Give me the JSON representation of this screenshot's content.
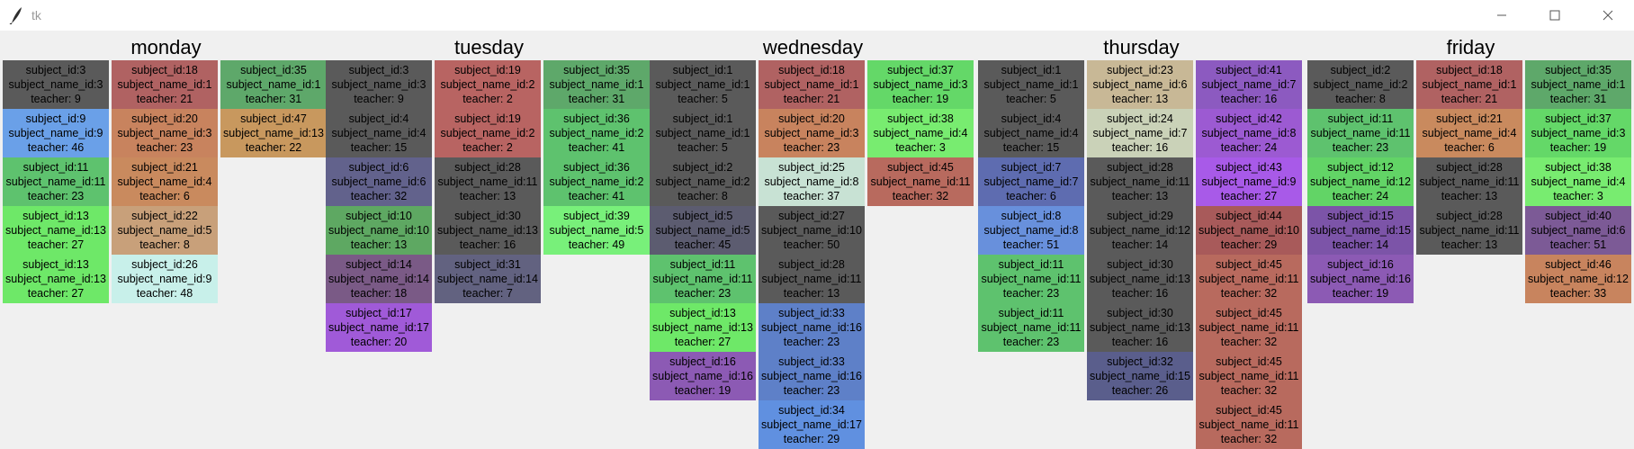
{
  "window": {
    "title": "tk"
  },
  "icons": {
    "app": "feather-icon",
    "minimize": "minimize-icon",
    "maximize": "maximize-icon",
    "close": "close-icon"
  },
  "days": [
    {
      "name": "monday",
      "columns": [
        [
          {
            "subject_id": "subject_id:3",
            "subject_name_id": "subject_name_id:3",
            "teacher": "teacher: 9",
            "color": "#5a5a5a"
          },
          {
            "subject_id": "subject_id:9",
            "subject_name_id": "subject_name_id:9",
            "teacher": "teacher: 46",
            "color": "#6aa0e8"
          },
          {
            "subject_id": "subject_id:11",
            "subject_name_id": "subject_name_id:11",
            "teacher": "teacher: 23",
            "color": "#5ec26e"
          },
          {
            "subject_id": "subject_id:13",
            "subject_name_id": "subject_name_id:13",
            "teacher": "teacher: 27",
            "color": "#6ee868"
          },
          {
            "subject_id": "subject_id:13",
            "subject_name_id": "subject_name_id:13",
            "teacher": "teacher: 27",
            "color": "#6ee868"
          }
        ],
        [
          {
            "subject_id": "subject_id:18",
            "subject_name_id": "subject_name_id:1",
            "teacher": "teacher: 21",
            "color": "#b06262"
          },
          {
            "subject_id": "subject_id:20",
            "subject_name_id": "subject_name_id:3",
            "teacher": "teacher: 23",
            "color": "#c8835e"
          },
          {
            "subject_id": "subject_id:21",
            "subject_name_id": "subject_name_id:4",
            "teacher": "teacher: 6",
            "color": "#c98a5e"
          },
          {
            "subject_id": "subject_id:22",
            "subject_name_id": "subject_name_id:5",
            "teacher": "teacher: 8",
            "color": "#c8a07a"
          },
          {
            "subject_id": "subject_id:26",
            "subject_name_id": "subject_name_id:9",
            "teacher": "teacher: 48",
            "color": "#c8f0ea"
          }
        ],
        [
          {
            "subject_id": "subject_id:35",
            "subject_name_id": "subject_name_id:1",
            "teacher": "teacher: 31",
            "color": "#5ea86a"
          },
          {
            "subject_id": "subject_id:47",
            "subject_name_id": "subject_name_id:13",
            "teacher": "teacher: 22",
            "color": "#c8985e"
          }
        ]
      ]
    },
    {
      "name": "tuesday",
      "columns": [
        [
          {
            "subject_id": "subject_id:3",
            "subject_name_id": "subject_name_id:3",
            "teacher": "teacher: 9",
            "color": "#5a5a5a"
          },
          {
            "subject_id": "subject_id:4",
            "subject_name_id": "subject_name_id:4",
            "teacher": "teacher: 15",
            "color": "#5a5a5a"
          },
          {
            "subject_id": "subject_id:6",
            "subject_name_id": "subject_name_id:6",
            "teacher": "teacher: 32",
            "color": "#62628c"
          },
          {
            "subject_id": "subject_id:10",
            "subject_name_id": "subject_name_id:10",
            "teacher": "teacher: 13",
            "color": "#5ea862"
          },
          {
            "subject_id": "subject_id:14",
            "subject_name_id": "subject_name_id:14",
            "teacher": "teacher: 18",
            "color": "#7a5a86"
          },
          {
            "subject_id": "subject_id:17",
            "subject_name_id": "subject_name_id:17",
            "teacher": "teacher: 20",
            "color": "#a05ad8"
          }
        ],
        [
          {
            "subject_id": "subject_id:19",
            "subject_name_id": "subject_name_id:2",
            "teacher": "teacher: 2",
            "color": "#b86462"
          },
          {
            "subject_id": "subject_id:19",
            "subject_name_id": "subject_name_id:2",
            "teacher": "teacher: 2",
            "color": "#b86462"
          },
          {
            "subject_id": "subject_id:28",
            "subject_name_id": "subject_name_id:11",
            "teacher": "teacher: 13",
            "color": "#5a5a5a"
          },
          {
            "subject_id": "subject_id:30",
            "subject_name_id": "subject_name_id:13",
            "teacher": "teacher: 16",
            "color": "#5a5a5a"
          },
          {
            "subject_id": "subject_id:31",
            "subject_name_id": "subject_name_id:14",
            "teacher": "teacher: 7",
            "color": "#626280"
          }
        ],
        [
          {
            "subject_id": "subject_id:35",
            "subject_name_id": "subject_name_id:1",
            "teacher": "teacher: 31",
            "color": "#5ea86a"
          },
          {
            "subject_id": "subject_id:36",
            "subject_name_id": "subject_name_id:2",
            "teacher": "teacher: 41",
            "color": "#5ec26e"
          },
          {
            "subject_id": "subject_id:36",
            "subject_name_id": "subject_name_id:2",
            "teacher": "teacher: 41",
            "color": "#5ec26e"
          },
          {
            "subject_id": "subject_id:39",
            "subject_name_id": "subject_name_id:5",
            "teacher": "teacher: 49",
            "color": "#78f07a"
          }
        ]
      ]
    },
    {
      "name": "wednesday",
      "columns": [
        [
          {
            "subject_id": "subject_id:1",
            "subject_name_id": "subject_name_id:1",
            "teacher": "teacher: 5",
            "color": "#5a5a5a"
          },
          {
            "subject_id": "subject_id:1",
            "subject_name_id": "subject_name_id:1",
            "teacher": "teacher: 5",
            "color": "#5a5a5a"
          },
          {
            "subject_id": "subject_id:2",
            "subject_name_id": "subject_name_id:2",
            "teacher": "teacher: 8",
            "color": "#5a5a5a"
          },
          {
            "subject_id": "subject_id:5",
            "subject_name_id": "subject_name_id:5",
            "teacher": "teacher: 45",
            "color": "#5c5c70"
          },
          {
            "subject_id": "subject_id:11",
            "subject_name_id": "subject_name_id:11",
            "teacher": "teacher: 23",
            "color": "#5ec26e"
          },
          {
            "subject_id": "subject_id:13",
            "subject_name_id": "subject_name_id:13",
            "teacher": "teacher: 27",
            "color": "#6ee868"
          },
          {
            "subject_id": "subject_id:16",
            "subject_name_id": "subject_name_id:16",
            "teacher": "teacher: 19",
            "color": "#8c5ab4"
          }
        ],
        [
          {
            "subject_id": "subject_id:18",
            "subject_name_id": "subject_name_id:1",
            "teacher": "teacher: 21",
            "color": "#b06262"
          },
          {
            "subject_id": "subject_id:20",
            "subject_name_id": "subject_name_id:3",
            "teacher": "teacher: 23",
            "color": "#c8835e"
          },
          {
            "subject_id": "subject_id:25",
            "subject_name_id": "subject_name_id:8",
            "teacher": "teacher: 37",
            "color": "#c8e2d4"
          },
          {
            "subject_id": "subject_id:27",
            "subject_name_id": "subject_name_id:10",
            "teacher": "teacher: 50",
            "color": "#5a5a5a"
          },
          {
            "subject_id": "subject_id:28",
            "subject_name_id": "subject_name_id:11",
            "teacher": "teacher: 13",
            "color": "#5a5a5a"
          },
          {
            "subject_id": "subject_id:33",
            "subject_name_id": "subject_name_id:16",
            "teacher": "teacher: 23",
            "color": "#5e80c8"
          },
          {
            "subject_id": "subject_id:33",
            "subject_name_id": "subject_name_id:16",
            "teacher": "teacher: 23",
            "color": "#5e80c8"
          },
          {
            "subject_id": "subject_id:34",
            "subject_name_id": "subject_name_id:17",
            "teacher": "teacher: 29",
            "color": "#6090e0"
          }
        ],
        [
          {
            "subject_id": "subject_id:37",
            "subject_name_id": "subject_name_id:3",
            "teacher": "teacher: 19",
            "color": "#64d868"
          },
          {
            "subject_id": "subject_id:38",
            "subject_name_id": "subject_name_id:4",
            "teacher": "teacher: 3",
            "color": "#78ec70"
          },
          {
            "subject_id": "subject_id:45",
            "subject_name_id": "subject_name_id:11",
            "teacher": "teacher: 32",
            "color": "#b86a5e"
          }
        ]
      ]
    },
    {
      "name": "thursday",
      "columns": [
        [
          {
            "subject_id": "subject_id:1",
            "subject_name_id": "subject_name_id:1",
            "teacher": "teacher: 5",
            "color": "#5a5a5a"
          },
          {
            "subject_id": "subject_id:4",
            "subject_name_id": "subject_name_id:4",
            "teacher": "teacher: 15",
            "color": "#5a5a5a"
          },
          {
            "subject_id": "subject_id:7",
            "subject_name_id": "subject_name_id:7",
            "teacher": "teacher: 6",
            "color": "#5e6cb0"
          },
          {
            "subject_id": "subject_id:8",
            "subject_name_id": "subject_name_id:8",
            "teacher": "teacher: 51",
            "color": "#6890dc"
          },
          {
            "subject_id": "subject_id:11",
            "subject_name_id": "subject_name_id:11",
            "teacher": "teacher: 23",
            "color": "#5ec26e"
          },
          {
            "subject_id": "subject_id:11",
            "subject_name_id": "subject_name_id:11",
            "teacher": "teacher: 23",
            "color": "#5ec26e"
          }
        ],
        [
          {
            "subject_id": "subject_id:23",
            "subject_name_id": "subject_name_id:6",
            "teacher": "teacher: 13",
            "color": "#c8b896"
          },
          {
            "subject_id": "subject_id:24",
            "subject_name_id": "subject_name_id:7",
            "teacher": "teacher: 16",
            "color": "#cad2b8"
          },
          {
            "subject_id": "subject_id:28",
            "subject_name_id": "subject_name_id:11",
            "teacher": "teacher: 13",
            "color": "#5a5a5a"
          },
          {
            "subject_id": "subject_id:29",
            "subject_name_id": "subject_name_id:12",
            "teacher": "teacher: 14",
            "color": "#5a5a5a"
          },
          {
            "subject_id": "subject_id:30",
            "subject_name_id": "subject_name_id:13",
            "teacher": "teacher: 16",
            "color": "#5a5a5a"
          },
          {
            "subject_id": "subject_id:30",
            "subject_name_id": "subject_name_id:13",
            "teacher": "teacher: 16",
            "color": "#5a5a5a"
          },
          {
            "subject_id": "subject_id:32",
            "subject_name_id": "subject_name_id:15",
            "teacher": "teacher: 26",
            "color": "#5a5e8c"
          }
        ],
        [
          {
            "subject_id": "subject_id:41",
            "subject_name_id": "subject_name_id:7",
            "teacher": "teacher: 16",
            "color": "#8c5ac0"
          },
          {
            "subject_id": "subject_id:42",
            "subject_name_id": "subject_name_id:8",
            "teacher": "teacher: 24",
            "color": "#9c5ad2"
          },
          {
            "subject_id": "subject_id:43",
            "subject_name_id": "subject_name_id:9",
            "teacher": "teacher: 27",
            "color": "#a85ae8"
          },
          {
            "subject_id": "subject_id:44",
            "subject_name_id": "subject_name_id:10",
            "teacher": "teacher: 29",
            "color": "#a85a5a"
          },
          {
            "subject_id": "subject_id:45",
            "subject_name_id": "subject_name_id:11",
            "teacher": "teacher: 32",
            "color": "#b86a5e"
          },
          {
            "subject_id": "subject_id:45",
            "subject_name_id": "subject_name_id:11",
            "teacher": "teacher: 32",
            "color": "#b86a5e"
          },
          {
            "subject_id": "subject_id:45",
            "subject_name_id": "subject_name_id:11",
            "teacher": "teacher: 32",
            "color": "#b86a5e"
          },
          {
            "subject_id": "subject_id:45",
            "subject_name_id": "subject_name_id:11",
            "teacher": "teacher: 32",
            "color": "#b86a5e"
          }
        ]
      ]
    },
    {
      "name": "friday",
      "columns": [
        [
          {
            "subject_id": "subject_id:2",
            "subject_name_id": "subject_name_id:2",
            "teacher": "teacher: 8",
            "color": "#5a5a5a"
          },
          {
            "subject_id": "subject_id:11",
            "subject_name_id": "subject_name_id:11",
            "teacher": "teacher: 23",
            "color": "#5ec26e"
          },
          {
            "subject_id": "subject_id:12",
            "subject_name_id": "subject_name_id:12",
            "teacher": "teacher: 24",
            "color": "#62d466"
          },
          {
            "subject_id": "subject_id:15",
            "subject_name_id": "subject_name_id:15",
            "teacher": "teacher: 14",
            "color": "#7c54a8"
          },
          {
            "subject_id": "subject_id:16",
            "subject_name_id": "subject_name_id:16",
            "teacher": "teacher: 19",
            "color": "#8c5ab4"
          }
        ],
        [
          {
            "subject_id": "subject_id:18",
            "subject_name_id": "subject_name_id:1",
            "teacher": "teacher: 21",
            "color": "#b06262"
          },
          {
            "subject_id": "subject_id:21",
            "subject_name_id": "subject_name_id:4",
            "teacher": "teacher: 6",
            "color": "#c98a5e"
          },
          {
            "subject_id": "subject_id:28",
            "subject_name_id": "subject_name_id:11",
            "teacher": "teacher: 13",
            "color": "#5a5a5a"
          },
          {
            "subject_id": "subject_id:28",
            "subject_name_id": "subject_name_id:11",
            "teacher": "teacher: 13",
            "color": "#5a5a5a"
          }
        ],
        [
          {
            "subject_id": "subject_id:35",
            "subject_name_id": "subject_name_id:1",
            "teacher": "teacher: 31",
            "color": "#5ea86a"
          },
          {
            "subject_id": "subject_id:37",
            "subject_name_id": "subject_name_id:3",
            "teacher": "teacher: 19",
            "color": "#64d868"
          },
          {
            "subject_id": "subject_id:38",
            "subject_name_id": "subject_name_id:4",
            "teacher": "teacher: 3",
            "color": "#78ec70"
          },
          {
            "subject_id": "subject_id:40",
            "subject_name_id": "subject_name_id:6",
            "teacher": "teacher: 51",
            "color": "#7c5a96"
          },
          {
            "subject_id": "subject_id:46",
            "subject_name_id": "subject_name_id:12",
            "teacher": "teacher: 33",
            "color": "#c8845e"
          }
        ]
      ]
    }
  ]
}
